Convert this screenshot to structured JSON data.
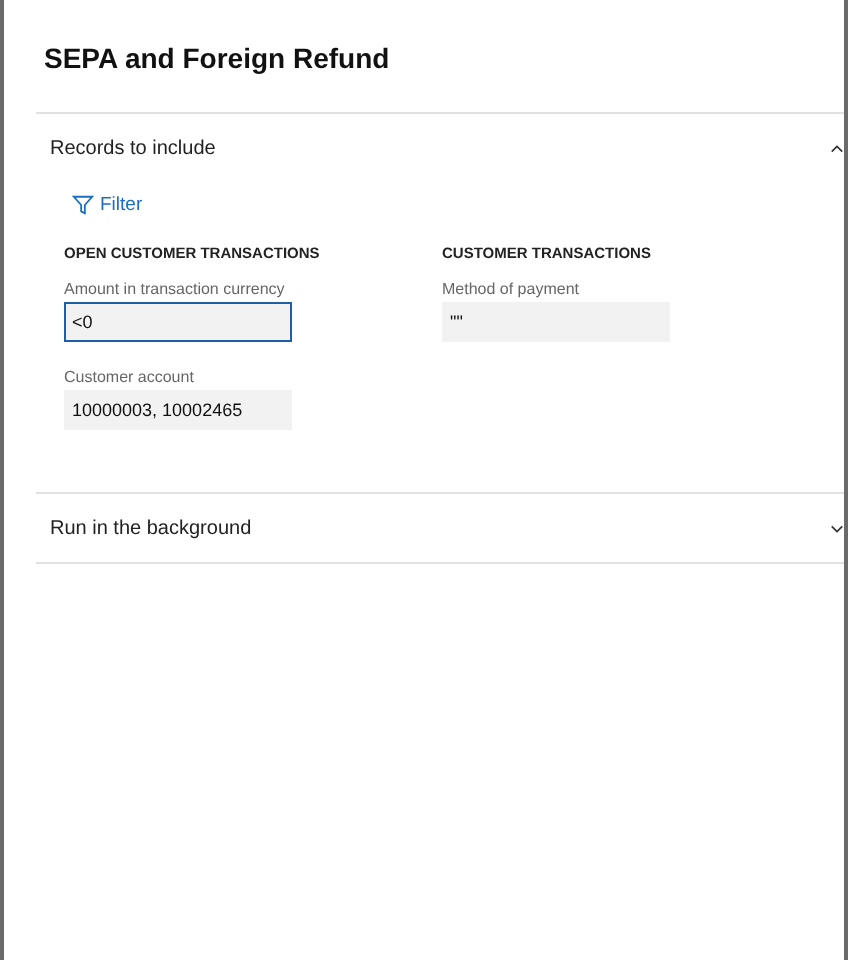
{
  "dialog": {
    "title": "SEPA and Foreign Refund"
  },
  "sections": [
    {
      "title": "Records to include",
      "expanded": true,
      "filter_button": "Filter",
      "groups": [
        {
          "heading": "OPEN CUSTOMER TRANSACTIONS",
          "fields": [
            {
              "label": "Amount in transaction currency",
              "value": "<0",
              "focused": true
            },
            {
              "label": "Customer account",
              "value": "10000003, 10002465",
              "focused": false
            }
          ]
        },
        {
          "heading": "CUSTOMER TRANSACTIONS",
          "fields": [
            {
              "label": "Method of payment",
              "value": "\"\"",
              "focused": false
            }
          ]
        }
      ]
    },
    {
      "title": "Run in the background",
      "expanded": false
    }
  ]
}
